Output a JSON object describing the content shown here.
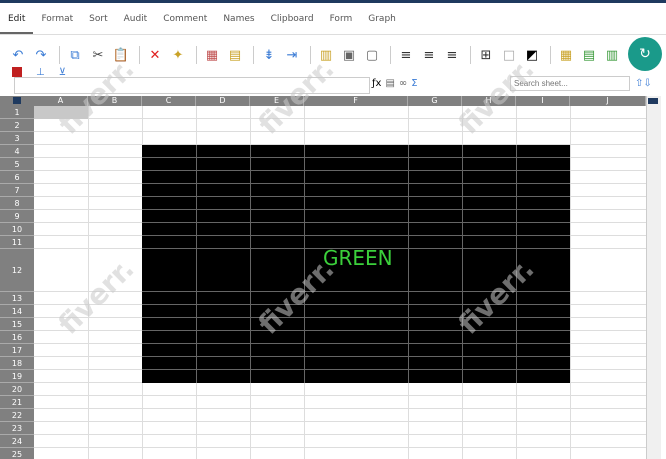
{
  "menu": [
    "Edit",
    "Format",
    "Sort",
    "Audit",
    "Comment",
    "Names",
    "Clipboard",
    "Form",
    "Graph"
  ],
  "search": {
    "placeholder": "Search sheet..."
  },
  "columns": [
    "A",
    "B",
    "C",
    "D",
    "E",
    "F",
    "G",
    "H",
    "I",
    "J"
  ],
  "rows": [
    "1",
    "2",
    "3",
    "4",
    "5",
    "6",
    "7",
    "8",
    "9",
    "10",
    "11",
    "12",
    "13",
    "14",
    "15",
    "16",
    "17",
    "18",
    "19",
    "20",
    "21",
    "22",
    "23",
    "24",
    "25"
  ],
  "cell_text": "GREEN",
  "watermark": "fiverr.",
  "colors": {
    "accent": "#1a9a8a",
    "header": "#808080",
    "text": "#3bd03b"
  }
}
